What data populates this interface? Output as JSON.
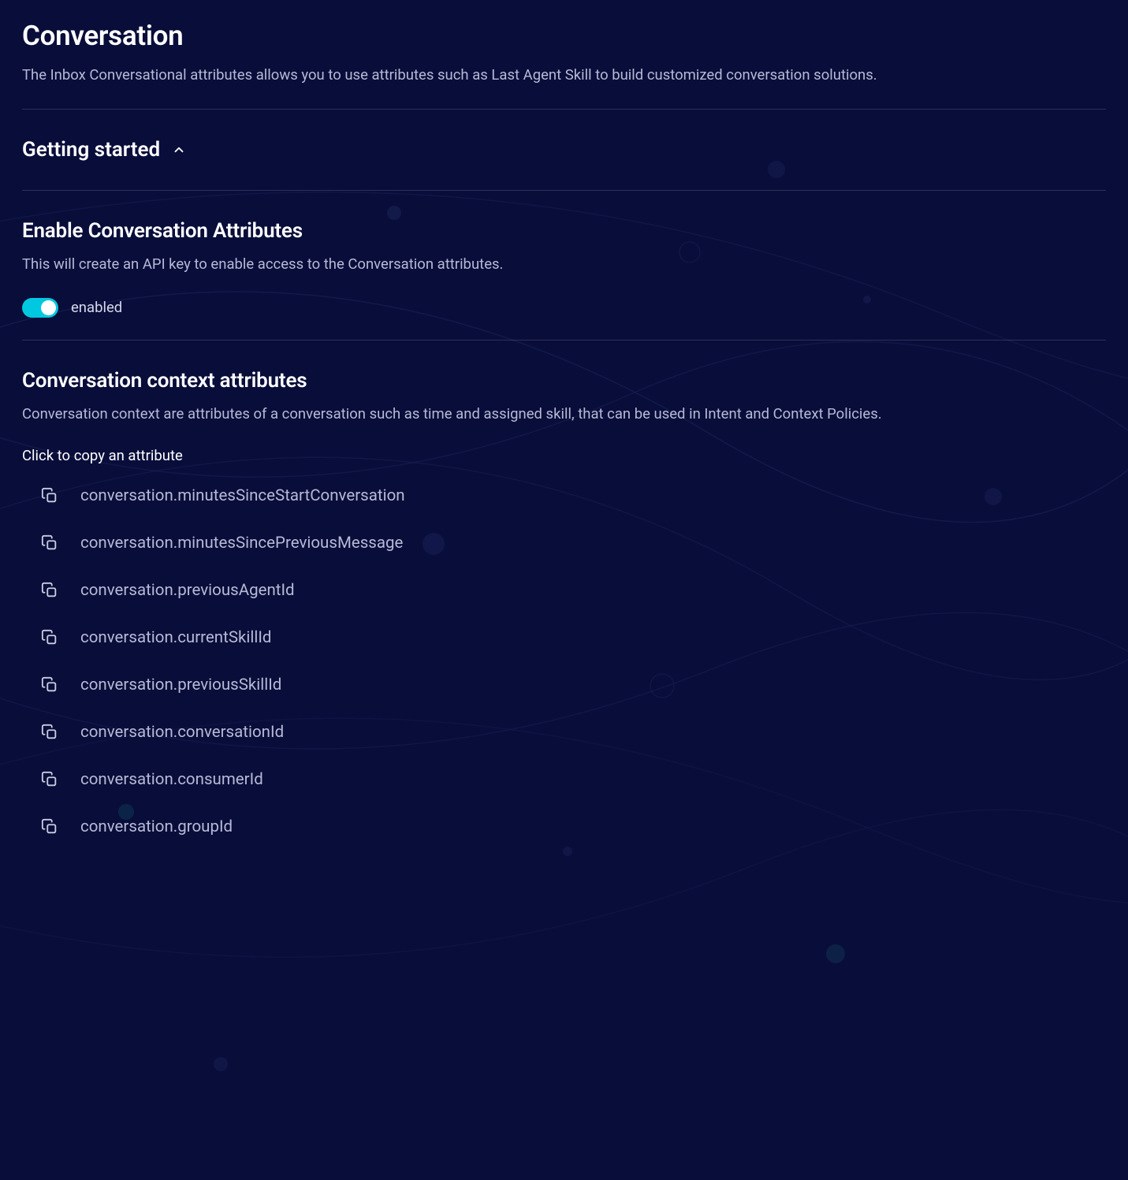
{
  "page": {
    "title": "Conversation",
    "subtitle": "The Inbox Conversational attributes allows you to use attributes such as Last Agent Skill to build customized conversation solutions."
  },
  "getting_started": {
    "title": "Getting started",
    "expanded": true
  },
  "enable_section": {
    "heading": "Enable Conversation Attributes",
    "description": "This will create an API key to enable access to the Conversation attributes.",
    "toggle_enabled": true,
    "toggle_label": "enabled"
  },
  "context_section": {
    "heading": "Conversation context attributes",
    "description": "Conversation context are attributes of a conversation such as time and assigned skill, that can be used in Intent and Context Policies.",
    "copy_instruction": "Click to copy an attribute"
  },
  "attributes": [
    "conversation.minutesSinceStartConversation",
    "conversation.minutesSincePreviousMessage",
    "conversation.previousAgentId",
    "conversation.currentSkillId",
    "conversation.previousSkillId",
    "conversation.conversationId",
    "conversation.consumerId",
    "conversation.groupId"
  ]
}
